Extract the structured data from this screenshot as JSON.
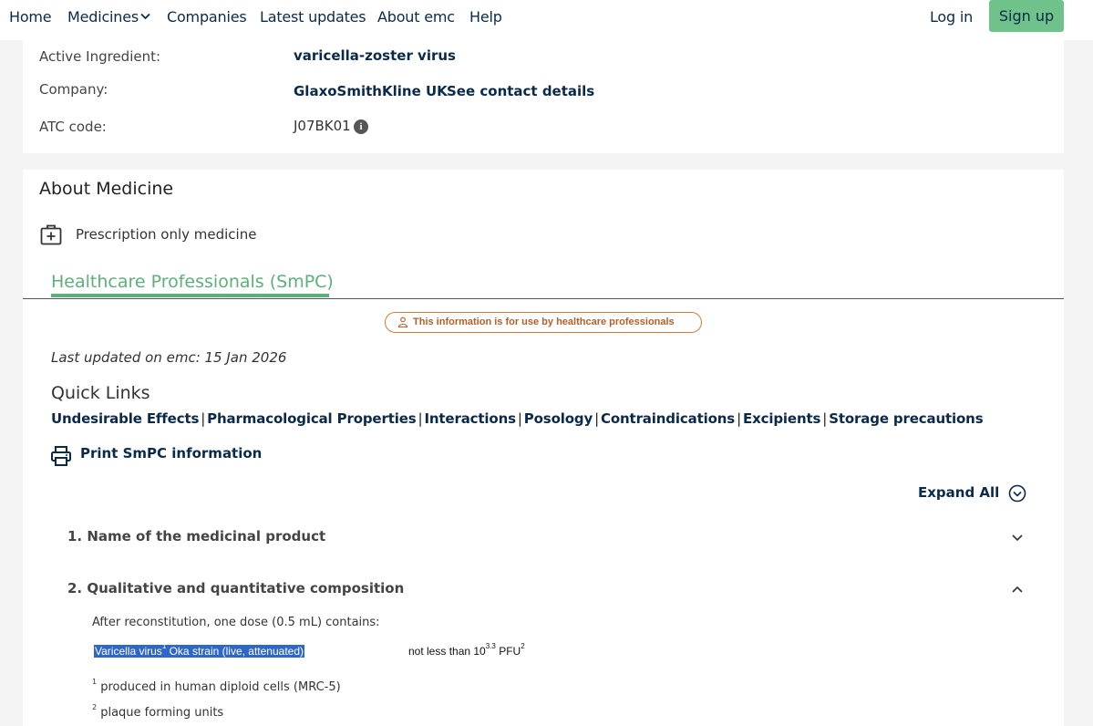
{
  "nav": {
    "home": "Home",
    "medicines": "Medicines",
    "companies": "Companies",
    "latest_updates": "Latest updates",
    "about": "About emc",
    "help": "Help",
    "login": "Log in",
    "signup": "Sign up"
  },
  "details": {
    "active_ingredient_label": "Active Ingredient:",
    "active_ingredient_value": "varicella-zoster virus",
    "company_label": "Company:",
    "company_value": "GlaxoSmithKline UK",
    "company_contact": "See contact details",
    "atc_label": "ATC code:",
    "atc_value": "J07BK01"
  },
  "about": {
    "title": "About Medicine",
    "prescription": "Prescription only medicine"
  },
  "tabs": {
    "active": "Healthcare Professionals (SmPC)"
  },
  "hcp_notice": "This information is for use by healthcare professionals",
  "last_updated": "Last updated on emc: 15 Jan 2026",
  "quick_links": {
    "title": "Quick Links",
    "items": [
      "Undesirable Effects",
      "Pharmacological Properties",
      "Interactions",
      "Posology",
      "Contraindications",
      "Excipients",
      "Storage precautions"
    ]
  },
  "print_label": "Print SmPC information",
  "expand_all": "Expand All",
  "sections": [
    {
      "title": "1. Name of the medicinal product",
      "expanded": false
    },
    {
      "title": "2. Qualitative and quantitative composition",
      "expanded": true
    }
  ],
  "composition": {
    "intro": "After reconstitution, one dose (0.5 mL) contains:",
    "row_name_a": "Varicella virus",
    "row_name_sup": "1",
    "row_name_b": " Oka strain (live, attenuated)",
    "row_value_a": "not less than 10",
    "row_value_exp": "3.3",
    "row_value_b": " PFU",
    "row_value_sup": "2",
    "footnote1_mark": "1",
    "footnote1": " produced in human diploid cells (MRC-5)",
    "footnote2_mark": "2",
    "footnote2": " plaque forming units"
  }
}
